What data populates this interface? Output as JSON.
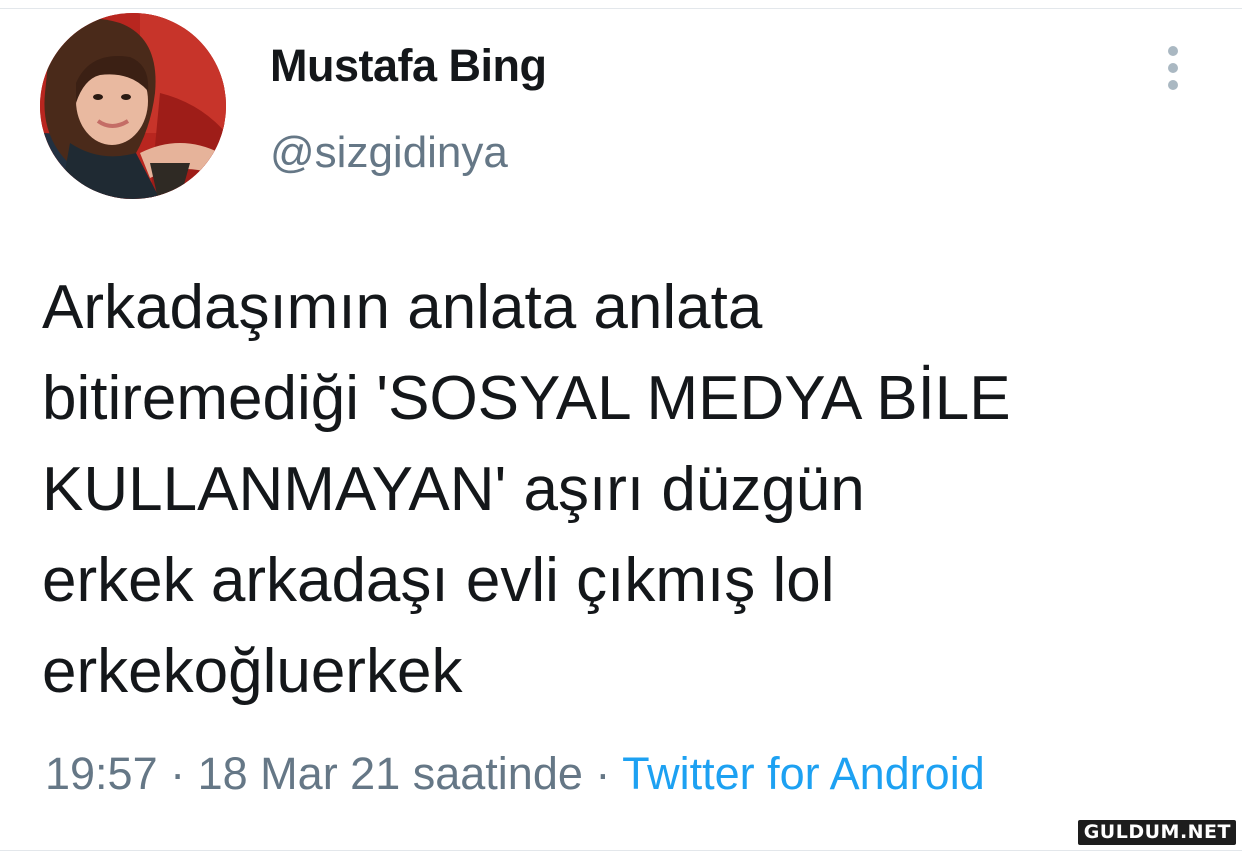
{
  "tweet": {
    "display_name": "Mustafa Bing",
    "handle": "@sizgidinya",
    "text_lines": [
      "Arkadaşımın anlata anlata",
      "bitiremediği 'SOSYAL MEDYA BİLE",
      "KULLANMAYAN' aşırı düzgün",
      "erkek arkadaşı evli çıkmış lol",
      "erkekoğluerkek"
    ],
    "time": "19:57",
    "separator": " · ",
    "date": "18 Mar 21 saatinde",
    "source": "Twitter for Android"
  },
  "icons": {
    "more": "more-vertical-icon",
    "avatar": "profile-photo"
  },
  "watermark": "GULDUM.NET",
  "colors": {
    "text": "#14171a",
    "secondary": "#657786",
    "link": "#1da1f2"
  }
}
